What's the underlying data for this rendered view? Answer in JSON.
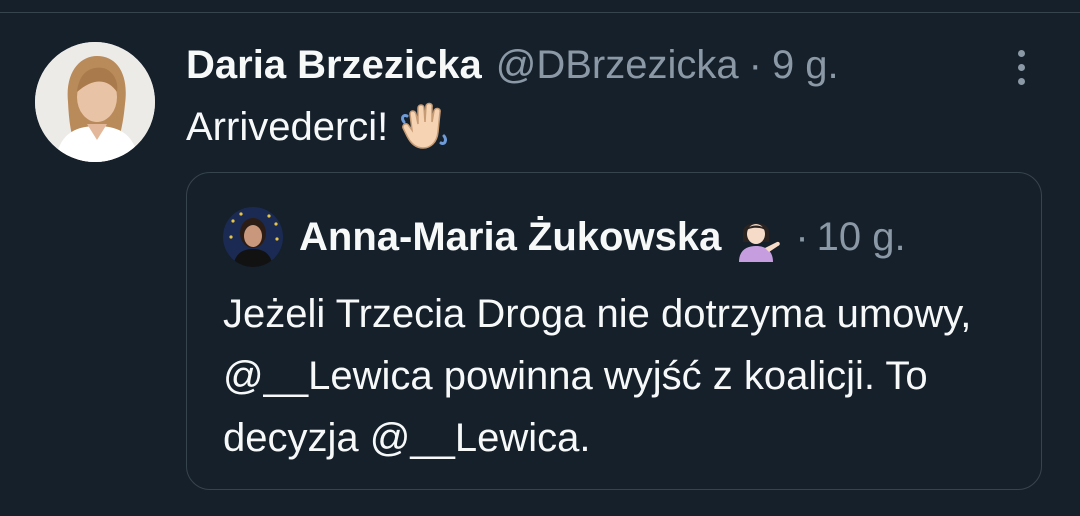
{
  "tweet": {
    "author_name": "Daria Brzezicka",
    "handle": "@DBrzezicka",
    "separator": "·",
    "time": "9 g.",
    "text": "Arrivederci!",
    "emoji_icon": "waving-hand-icon",
    "more_icon": "more-vertical-icon"
  },
  "quoted_tweet": {
    "author_name": "Anna-Maria Żukowska",
    "emoji_icon": "person-tipping-hand-icon",
    "separator": "·",
    "time": "10 g.",
    "text": "Jeżeli Trzecia Droga nie dotrzyma umowy, @__Lewica powinna wyjść z koalicji. To decyzja @__Lewica."
  },
  "colors": {
    "background": "#15202b",
    "primary_text": "#f7f9f9",
    "secondary_text": "#8b98a5",
    "border": "#38444d"
  }
}
